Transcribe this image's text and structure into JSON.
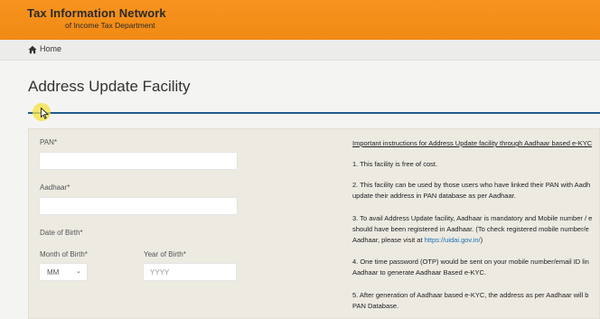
{
  "header": {
    "title": "Tax Information Network",
    "subtitle": "of Income Tax Department"
  },
  "breadcrumb": {
    "home_label": "Home"
  },
  "page": {
    "title": "Address Update Facility"
  },
  "form": {
    "pan_label": "PAN*",
    "pan_value": "",
    "aadhaar_label": "Aadhaar*",
    "aadhaar_value": "",
    "dob_label": "Date of Birth*",
    "month_label": "Month of Birth*",
    "month_value": "MM",
    "year_label": "Year of Birth*",
    "year_placeholder": "YYYY"
  },
  "instructions": {
    "heading": "Important instructions for Address Update facility through Aadhaar based e-KYC",
    "item1": "1. This facility is free of cost.",
    "item2_line1": "2. This facility can be used by those users who have linked their PAN with Aadh",
    "item2_line2": "update their address in PAN database as per Aadhaar.",
    "item3_line1": "3. To avail Address Update facility, Aadhaar is mandatory and Mobile number / e",
    "item3_line2": "should have been registered in Aadhaar. (To check registered mobile number/e",
    "item3_line3_pre": "Aadhaar, please visit at ",
    "item3_link": "https://uidai.gov.in/",
    "item3_line3_post": ")",
    "item4_line1": "4. One time password (OTP) would be sent on your mobile number/email ID lin",
    "item4_line2": "Aadhaar to generate Aadhaar Based e-KYC.",
    "item5_line1": "5. After generation of Aadhaar based e-KYC, the address as per Aadhaar will b",
    "item5_line2": "PAN Database."
  },
  "colors": {
    "header_orange": "#f08a14",
    "title_rule_blue": "#1f5b8f",
    "link_blue": "#1a6fb3"
  },
  "icons": {
    "home": "home-icon",
    "caret": "chevron-down-icon",
    "cursor": "mouse-cursor-icon"
  }
}
